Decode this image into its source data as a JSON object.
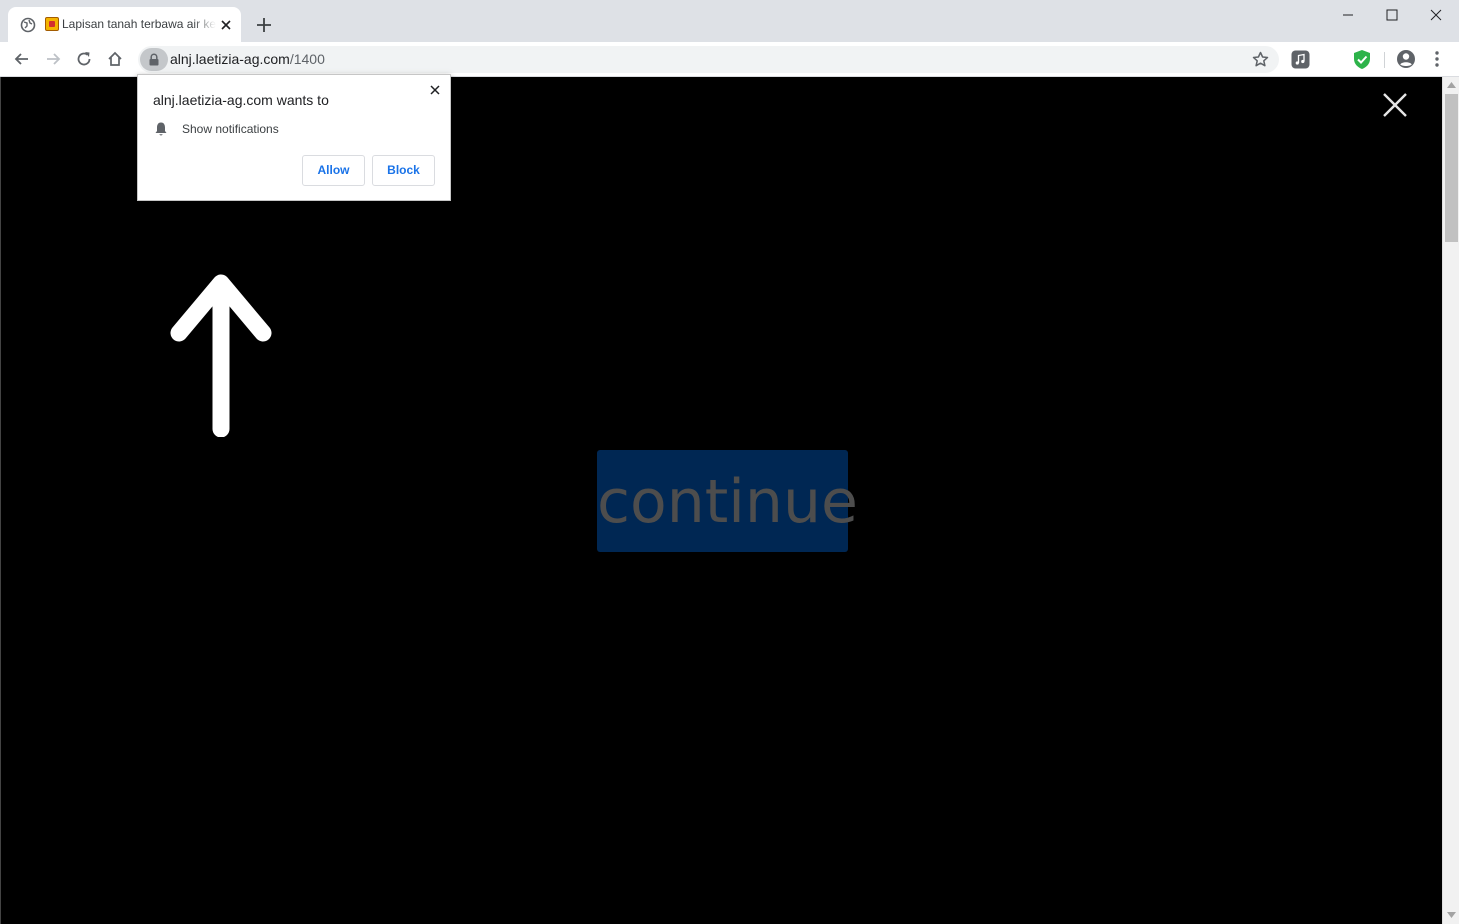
{
  "browser": {
    "tab": {
      "title": "Lapisan tanah terbawa air ketika hujan"
    },
    "address_bar": {
      "host": "alnj.laetizia-ag.com",
      "path": "/1400"
    }
  },
  "permission_prompt": {
    "title": "alnj.laetizia-ag.com wants to",
    "permission": "Show notifications",
    "allow_label": "Allow",
    "block_label": "Block"
  },
  "page": {
    "continue_label": "continue",
    "continue_bg": "#002753",
    "continue_text_color": "#4d4d4d"
  },
  "colors": {
    "accent": "#1a73e8",
    "shield_green": "#2db34a"
  }
}
